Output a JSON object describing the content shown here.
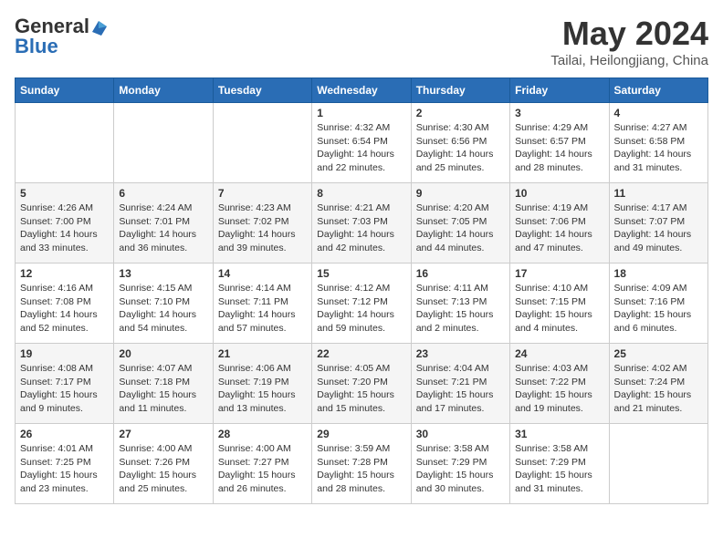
{
  "header": {
    "logo_general": "General",
    "logo_blue": "Blue",
    "month_title": "May 2024",
    "location": "Tailai, Heilongjiang, China"
  },
  "weekdays": [
    "Sunday",
    "Monday",
    "Tuesday",
    "Wednesday",
    "Thursday",
    "Friday",
    "Saturday"
  ],
  "weeks": [
    [
      {
        "day": "",
        "sunrise": "",
        "sunset": "",
        "daylight": ""
      },
      {
        "day": "",
        "sunrise": "",
        "sunset": "",
        "daylight": ""
      },
      {
        "day": "",
        "sunrise": "",
        "sunset": "",
        "daylight": ""
      },
      {
        "day": "1",
        "sunrise": "Sunrise: 4:32 AM",
        "sunset": "Sunset: 6:54 PM",
        "daylight": "Daylight: 14 hours and 22 minutes."
      },
      {
        "day": "2",
        "sunrise": "Sunrise: 4:30 AM",
        "sunset": "Sunset: 6:56 PM",
        "daylight": "Daylight: 14 hours and 25 minutes."
      },
      {
        "day": "3",
        "sunrise": "Sunrise: 4:29 AM",
        "sunset": "Sunset: 6:57 PM",
        "daylight": "Daylight: 14 hours and 28 minutes."
      },
      {
        "day": "4",
        "sunrise": "Sunrise: 4:27 AM",
        "sunset": "Sunset: 6:58 PM",
        "daylight": "Daylight: 14 hours and 31 minutes."
      }
    ],
    [
      {
        "day": "5",
        "sunrise": "Sunrise: 4:26 AM",
        "sunset": "Sunset: 7:00 PM",
        "daylight": "Daylight: 14 hours and 33 minutes."
      },
      {
        "day": "6",
        "sunrise": "Sunrise: 4:24 AM",
        "sunset": "Sunset: 7:01 PM",
        "daylight": "Daylight: 14 hours and 36 minutes."
      },
      {
        "day": "7",
        "sunrise": "Sunrise: 4:23 AM",
        "sunset": "Sunset: 7:02 PM",
        "daylight": "Daylight: 14 hours and 39 minutes."
      },
      {
        "day": "8",
        "sunrise": "Sunrise: 4:21 AM",
        "sunset": "Sunset: 7:03 PM",
        "daylight": "Daylight: 14 hours and 42 minutes."
      },
      {
        "day": "9",
        "sunrise": "Sunrise: 4:20 AM",
        "sunset": "Sunset: 7:05 PM",
        "daylight": "Daylight: 14 hours and 44 minutes."
      },
      {
        "day": "10",
        "sunrise": "Sunrise: 4:19 AM",
        "sunset": "Sunset: 7:06 PM",
        "daylight": "Daylight: 14 hours and 47 minutes."
      },
      {
        "day": "11",
        "sunrise": "Sunrise: 4:17 AM",
        "sunset": "Sunset: 7:07 PM",
        "daylight": "Daylight: 14 hours and 49 minutes."
      }
    ],
    [
      {
        "day": "12",
        "sunrise": "Sunrise: 4:16 AM",
        "sunset": "Sunset: 7:08 PM",
        "daylight": "Daylight: 14 hours and 52 minutes."
      },
      {
        "day": "13",
        "sunrise": "Sunrise: 4:15 AM",
        "sunset": "Sunset: 7:10 PM",
        "daylight": "Daylight: 14 hours and 54 minutes."
      },
      {
        "day": "14",
        "sunrise": "Sunrise: 4:14 AM",
        "sunset": "Sunset: 7:11 PM",
        "daylight": "Daylight: 14 hours and 57 minutes."
      },
      {
        "day": "15",
        "sunrise": "Sunrise: 4:12 AM",
        "sunset": "Sunset: 7:12 PM",
        "daylight": "Daylight: 14 hours and 59 minutes."
      },
      {
        "day": "16",
        "sunrise": "Sunrise: 4:11 AM",
        "sunset": "Sunset: 7:13 PM",
        "daylight": "Daylight: 15 hours and 2 minutes."
      },
      {
        "day": "17",
        "sunrise": "Sunrise: 4:10 AM",
        "sunset": "Sunset: 7:15 PM",
        "daylight": "Daylight: 15 hours and 4 minutes."
      },
      {
        "day": "18",
        "sunrise": "Sunrise: 4:09 AM",
        "sunset": "Sunset: 7:16 PM",
        "daylight": "Daylight: 15 hours and 6 minutes."
      }
    ],
    [
      {
        "day": "19",
        "sunrise": "Sunrise: 4:08 AM",
        "sunset": "Sunset: 7:17 PM",
        "daylight": "Daylight: 15 hours and 9 minutes."
      },
      {
        "day": "20",
        "sunrise": "Sunrise: 4:07 AM",
        "sunset": "Sunset: 7:18 PM",
        "daylight": "Daylight: 15 hours and 11 minutes."
      },
      {
        "day": "21",
        "sunrise": "Sunrise: 4:06 AM",
        "sunset": "Sunset: 7:19 PM",
        "daylight": "Daylight: 15 hours and 13 minutes."
      },
      {
        "day": "22",
        "sunrise": "Sunrise: 4:05 AM",
        "sunset": "Sunset: 7:20 PM",
        "daylight": "Daylight: 15 hours and 15 minutes."
      },
      {
        "day": "23",
        "sunrise": "Sunrise: 4:04 AM",
        "sunset": "Sunset: 7:21 PM",
        "daylight": "Daylight: 15 hours and 17 minutes."
      },
      {
        "day": "24",
        "sunrise": "Sunrise: 4:03 AM",
        "sunset": "Sunset: 7:22 PM",
        "daylight": "Daylight: 15 hours and 19 minutes."
      },
      {
        "day": "25",
        "sunrise": "Sunrise: 4:02 AM",
        "sunset": "Sunset: 7:24 PM",
        "daylight": "Daylight: 15 hours and 21 minutes."
      }
    ],
    [
      {
        "day": "26",
        "sunrise": "Sunrise: 4:01 AM",
        "sunset": "Sunset: 7:25 PM",
        "daylight": "Daylight: 15 hours and 23 minutes."
      },
      {
        "day": "27",
        "sunrise": "Sunrise: 4:00 AM",
        "sunset": "Sunset: 7:26 PM",
        "daylight": "Daylight: 15 hours and 25 minutes."
      },
      {
        "day": "28",
        "sunrise": "Sunrise: 4:00 AM",
        "sunset": "Sunset: 7:27 PM",
        "daylight": "Daylight: 15 hours and 26 minutes."
      },
      {
        "day": "29",
        "sunrise": "Sunrise: 3:59 AM",
        "sunset": "Sunset: 7:28 PM",
        "daylight": "Daylight: 15 hours and 28 minutes."
      },
      {
        "day": "30",
        "sunrise": "Sunrise: 3:58 AM",
        "sunset": "Sunset: 7:29 PM",
        "daylight": "Daylight: 15 hours and 30 minutes."
      },
      {
        "day": "31",
        "sunrise": "Sunrise: 3:58 AM",
        "sunset": "Sunset: 7:29 PM",
        "daylight": "Daylight: 15 hours and 31 minutes."
      },
      {
        "day": "",
        "sunrise": "",
        "sunset": "",
        "daylight": ""
      }
    ]
  ]
}
